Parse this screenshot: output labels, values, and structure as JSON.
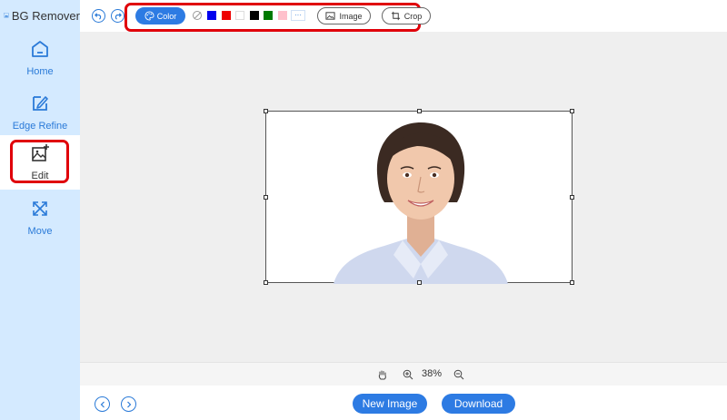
{
  "app": {
    "title": "BG Remover"
  },
  "sidebar": {
    "items": [
      {
        "label": "Home",
        "icon": "home-icon"
      },
      {
        "label": "Edge Refine",
        "icon": "pen-icon"
      },
      {
        "label": "Edit",
        "icon": "image-edit-icon",
        "active": true
      },
      {
        "label": "Move",
        "icon": "move-icon"
      }
    ]
  },
  "toolbar": {
    "color_label": "Color",
    "image_label": "Image",
    "crop_label": "Crop",
    "swatches": [
      "#0000ee",
      "#ee0000",
      "#ffffff",
      "#000000",
      "#007a00",
      "#ffc0cb"
    ],
    "more_label": "···"
  },
  "zoom": {
    "value": "38%"
  },
  "bottom": {
    "new_image_label": "New Image",
    "download_label": "Download"
  },
  "colors": {
    "accent": "#2d7be3",
    "sidebar_bg": "#d4eaff",
    "highlight": "#e0000a",
    "canvas_bg": "#efefef"
  }
}
